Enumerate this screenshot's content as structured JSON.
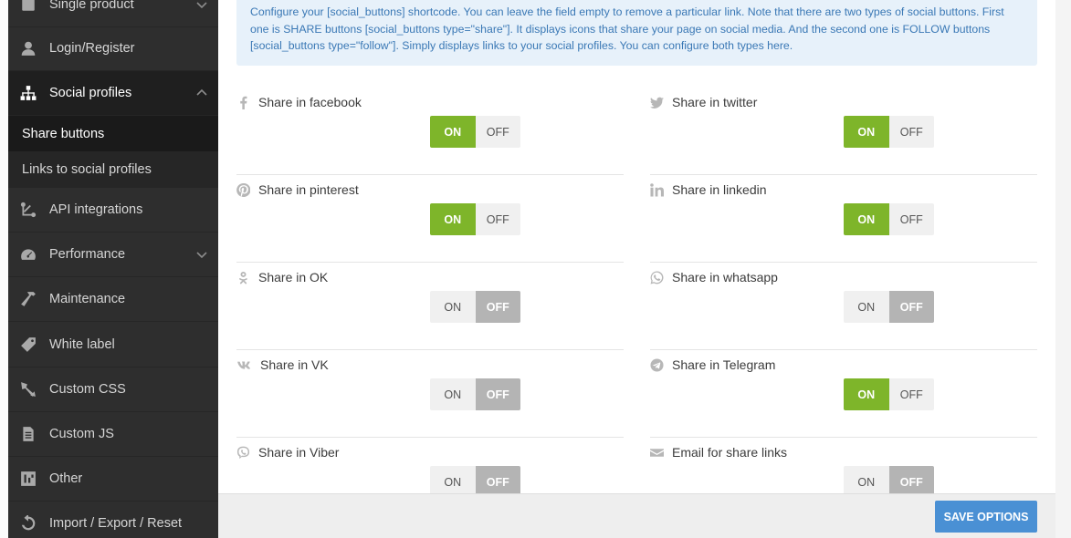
{
  "sidebar": {
    "items": [
      {
        "label": "Single product",
        "icon": "product-icon",
        "has_chevron": true
      },
      {
        "label": "Login/Register",
        "icon": "user-icon",
        "has_chevron": false
      },
      {
        "label": "Social profiles",
        "icon": "sitemap-icon",
        "has_chevron": true,
        "active": true
      },
      {
        "label": "API integrations",
        "icon": "api-icon",
        "has_chevron": false
      },
      {
        "label": "Performance",
        "icon": "dashboard-icon",
        "has_chevron": true
      },
      {
        "label": "Maintenance",
        "icon": "hammer-icon",
        "has_chevron": false
      },
      {
        "label": "White label",
        "icon": "tag-icon",
        "has_chevron": false
      },
      {
        "label": "Custom CSS",
        "icon": "brush-icon",
        "has_chevron": false
      },
      {
        "label": "Custom JS",
        "icon": "file-icon",
        "has_chevron": false
      },
      {
        "label": "Other",
        "icon": "other-icon",
        "has_chevron": false
      },
      {
        "label": "Import / Export / Reset",
        "icon": "reset-icon",
        "has_chevron": false
      }
    ],
    "sub_items": [
      {
        "label": "Share buttons",
        "current": true
      },
      {
        "label": "Links to social profiles",
        "current": false
      }
    ]
  },
  "info_text": "Configure your [social_buttons] shortcode. You can leave the field empty to remove a particular link. Note that there are two types of social buttons. First one is SHARE buttons [social_buttons type=\"share\"]. It displays icons that share your page on social media. And the second one is FOLLOW buttons [social_buttons type=\"follow\"]. Simply displays links to your social profiles. You can configure both types here.",
  "toggle_labels": {
    "on": "ON",
    "off": "OFF"
  },
  "options": [
    {
      "label": "Share in facebook",
      "icon": "facebook-icon",
      "state": "on"
    },
    {
      "label": "Share in twitter",
      "icon": "twitter-icon",
      "state": "on"
    },
    {
      "label": "Share in pinterest",
      "icon": "pinterest-icon",
      "state": "on"
    },
    {
      "label": "Share in linkedin",
      "icon": "linkedin-icon",
      "state": "on"
    },
    {
      "label": "Share in OK",
      "icon": "odnoklassniki-icon",
      "state": "off"
    },
    {
      "label": "Share in whatsapp",
      "icon": "whatsapp-icon",
      "state": "off"
    },
    {
      "label": "Share in VK",
      "icon": "vk-icon",
      "state": "off"
    },
    {
      "label": "Share in Telegram",
      "icon": "telegram-icon",
      "state": "on"
    },
    {
      "label": "Share in Viber",
      "icon": "viber-icon",
      "state": "off"
    },
    {
      "label": "Email for share links",
      "icon": "envelope-icon",
      "state": "off"
    }
  ],
  "footer": {
    "save_label": "SAVE OPTIONS"
  },
  "colors": {
    "accent_on": "#7eb52a",
    "save_button": "#4a90d4",
    "sidebar_bg": "#2e2e2e",
    "info_text": "#3a78b5"
  }
}
